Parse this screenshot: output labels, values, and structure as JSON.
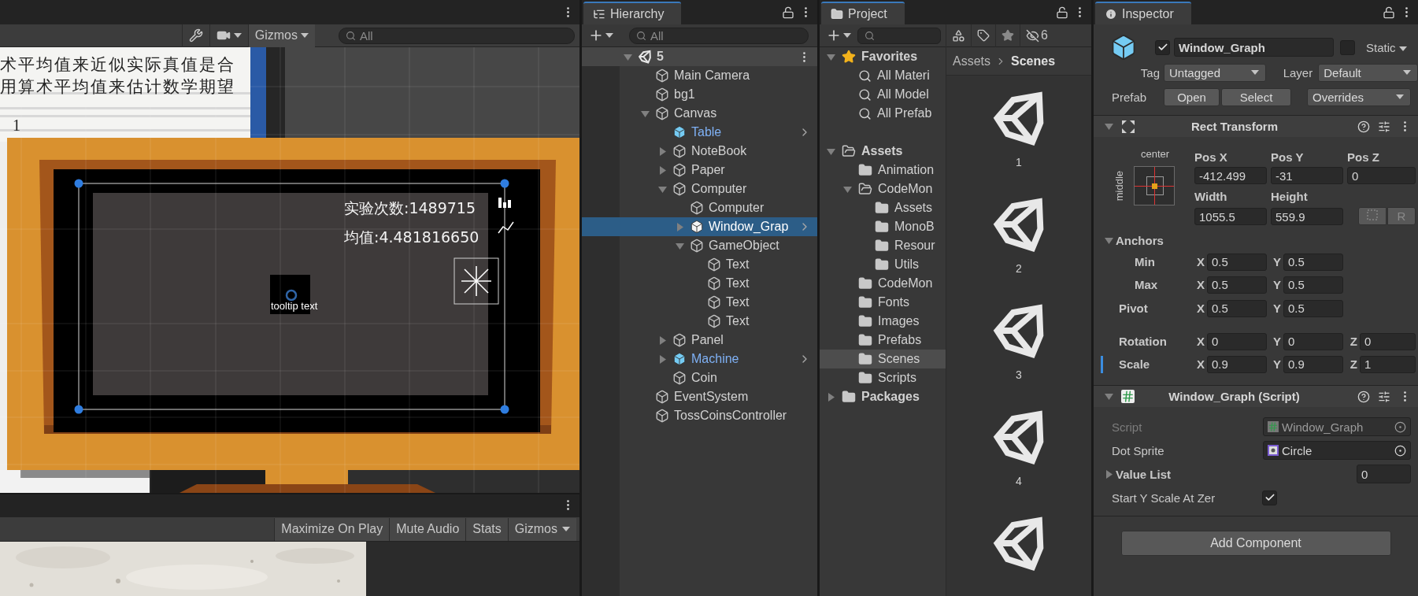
{
  "scene_view": {
    "toolbar": {
      "gizmos": "Gizmos",
      "search": {
        "placeholder": "All"
      }
    },
    "canvas": {
      "notebook_lines": [
        "术平均值来近似实际真值是合",
        "用算术平均值来估计数学期望"
      ],
      "notebook_number": "1",
      "stats": [
        "实验次数:1489715",
        "均值:4.481816650"
      ],
      "tooltip": "tooltip text"
    }
  },
  "game_view": {
    "toolbar": [
      "Maximize On Play",
      "Mute Audio",
      "Stats",
      "Gizmos"
    ]
  },
  "hierarchy": {
    "title": "Hierarchy",
    "search": {
      "placeholder": "All"
    },
    "scene": {
      "name": "5",
      "expanded": true
    },
    "items": [
      {
        "name": "Main Camera",
        "kind": "object",
        "selected": false
      },
      {
        "name": "bg1",
        "kind": "object",
        "selected": false
      },
      {
        "name": "Canvas",
        "kind": "object",
        "selected": false,
        "expanded": true,
        "children": [
          {
            "name": "Table",
            "kind": "prefab",
            "selected": false
          },
          {
            "name": "NoteBook",
            "kind": "object",
            "selected": false,
            "expanded": false
          },
          {
            "name": "Paper",
            "kind": "object",
            "selected": false,
            "expanded": false
          },
          {
            "name": "Computer",
            "kind": "object",
            "selected": false,
            "expanded": true,
            "children": [
              {
                "name": "Computer",
                "kind": "object",
                "selected": false
              },
              {
                "name": "Window_Grap",
                "kind": "prefab",
                "selected": true,
                "expanded": false
              },
              {
                "name": "GameObject",
                "kind": "object",
                "selected": false,
                "expanded": true,
                "children": [
                  {
                    "name": "Text",
                    "kind": "object",
                    "selected": false
                  },
                  {
                    "name": "Text",
                    "kind": "object",
                    "selected": false
                  },
                  {
                    "name": "Text",
                    "kind": "object",
                    "selected": false
                  },
                  {
                    "name": "Text",
                    "kind": "object",
                    "selected": false
                  }
                ]
              }
            ]
          },
          {
            "name": "Panel",
            "kind": "object",
            "selected": false,
            "expanded": false
          },
          {
            "name": "Machine",
            "kind": "prefab",
            "selected": false,
            "expanded": false
          },
          {
            "name": "Coin",
            "kind": "object",
            "selected": false
          }
        ]
      },
      {
        "name": "EventSystem",
        "kind": "object",
        "selected": false
      },
      {
        "name": "TossCoinsController",
        "kind": "object",
        "selected": false
      }
    ]
  },
  "project": {
    "title": "Project",
    "hidden_count": "6",
    "favorites": {
      "label": "Favorites",
      "expanded": true,
      "children": [
        {
          "label": "All Materi",
          "selected": false
        },
        {
          "label": "All Model",
          "selected": false
        },
        {
          "label": "All Prefab",
          "selected": false
        }
      ]
    },
    "folders": [
      {
        "label": "Assets",
        "expanded": true,
        "selected": false,
        "children": [
          {
            "label": "Animation",
            "selected": false
          },
          {
            "label": "CodeMon",
            "expanded": true,
            "selected": false,
            "children": [
              {
                "label": "Assets",
                "selected": false
              },
              {
                "label": "MonoB",
                "selected": false
              },
              {
                "label": "Resour",
                "selected": false
              },
              {
                "label": "Utils",
                "selected": false
              }
            ]
          },
          {
            "label": "CodeMon",
            "selected": false
          },
          {
            "label": "Fonts",
            "selected": false
          },
          {
            "label": "Images",
            "selected": false
          },
          {
            "label": "Prefabs",
            "selected": false
          },
          {
            "label": "Scenes",
            "selected": true
          },
          {
            "label": "Scripts",
            "selected": false
          }
        ]
      },
      {
        "label": "Packages",
        "expanded": false,
        "selected": false
      }
    ],
    "breadcrumb": [
      "Assets",
      "Scenes"
    ],
    "assets": [
      {
        "kind": "scene",
        "label": "1"
      },
      {
        "kind": "scene",
        "label": "2"
      },
      {
        "kind": "scene",
        "label": "3"
      },
      {
        "kind": "scene",
        "label": "4"
      },
      {
        "kind": "scene"
      }
    ]
  },
  "inspector": {
    "title": "Inspector",
    "object": {
      "active": true,
      "name": "Window_Graph",
      "static": false,
      "static_label": "Static",
      "tag_label": "Tag",
      "tag": "Untagged",
      "layer_label": "Layer",
      "layer": "Default",
      "prefab_label": "Prefab",
      "prefab_buttons": [
        "Open",
        "Select"
      ],
      "overrides": "Overrides"
    },
    "rect_transform": {
      "title": "Rect Transform",
      "expanded": true,
      "preset": {
        "horizontal": "center",
        "vertical": "middle"
      },
      "top_fields": [
        {
          "label": "Pos X",
          "value": "-412.499"
        },
        {
          "label": "Pos Y",
          "value": "-31"
        },
        {
          "label": "Pos Z",
          "value": "0"
        },
        {
          "label": "Width",
          "value": "1055.5"
        },
        {
          "label": "Height",
          "value": "559.9"
        }
      ],
      "raw_button": "R",
      "anchors": {
        "label": "Anchors",
        "expanded": true,
        "rows": [
          {
            "label": "Min",
            "values": [
              {
                "axis": "X",
                "value": "0.5"
              },
              {
                "axis": "Y",
                "value": "0.5"
              }
            ]
          },
          {
            "label": "Max",
            "values": [
              {
                "axis": "X",
                "value": "0.5"
              },
              {
                "axis": "Y",
                "value": "0.5"
              }
            ]
          }
        ]
      },
      "pivot": {
        "label": "Pivot",
        "values": [
          {
            "axis": "X",
            "value": "0.5"
          },
          {
            "axis": "Y",
            "value": "0.5"
          }
        ]
      },
      "transform_rows": [
        {
          "label": "Rotation",
          "overridden": false,
          "values": [
            {
              "axis": "X",
              "value": "0"
            },
            {
              "axis": "Y",
              "value": "0"
            },
            {
              "axis": "Z",
              "value": "0"
            }
          ]
        },
        {
          "label": "Scale",
          "overridden": true,
          "values": [
            {
              "axis": "X",
              "value": "0.9"
            },
            {
              "axis": "Y",
              "value": "0.9"
            },
            {
              "axis": "Z",
              "value": "1"
            }
          ]
        }
      ]
    },
    "script": {
      "title": "Window_Graph (Script)",
      "expanded": true,
      "properties": [
        {
          "kind": "script",
          "label": "Script",
          "value": "Window_Graph",
          "disabled": true
        },
        {
          "kind": "sprite",
          "label": "Dot Sprite",
          "value": "Circle",
          "disabled": false
        },
        {
          "kind": "list",
          "label": "Value List",
          "expanded": false,
          "value": "0"
        },
        {
          "kind": "toggle",
          "label": "Start Y Scale At Zer",
          "checked": true
        }
      ]
    },
    "add_button": "Add Component"
  }
}
